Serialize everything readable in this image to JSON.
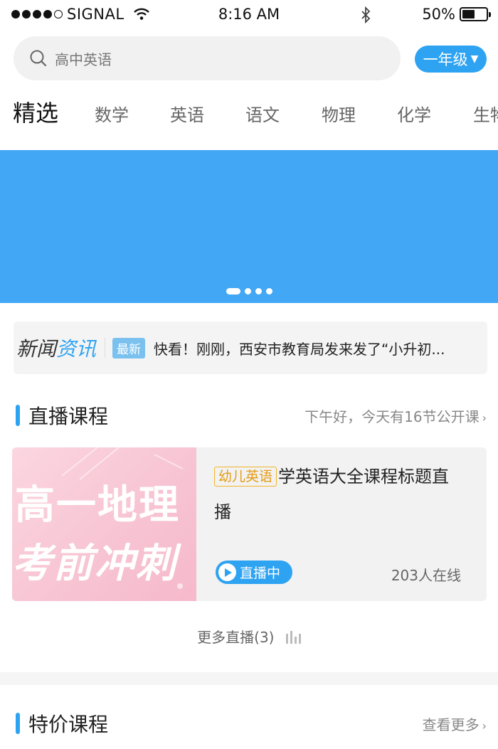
{
  "status_bar": {
    "carrier": "SIGNAL",
    "time": "8:16 AM",
    "battery": "50%"
  },
  "search": {
    "placeholder": "高中英语"
  },
  "grade_selector": {
    "label": "一年级"
  },
  "tabs": [
    {
      "label": "精选",
      "active": true
    },
    {
      "label": "数学",
      "active": false
    },
    {
      "label": "英语",
      "active": false
    },
    {
      "label": "语文",
      "active": false
    },
    {
      "label": "物理",
      "active": false
    },
    {
      "label": "化学",
      "active": false
    },
    {
      "label": "生物",
      "active": false
    }
  ],
  "banner": {
    "color": "#42a7f5",
    "slide_count": 4,
    "active_slide": 1
  },
  "news": {
    "logo_part1": "新闻",
    "logo_part2": "资讯",
    "badge": "最新",
    "headline": "快看！刚刚，西安市教育局发来发了“小升初..."
  },
  "live_section": {
    "title": "直播课程",
    "more": "下午好，今天有16节公开课",
    "card": {
      "thumb_line1": "高一地理",
      "thumb_line2": "考前冲刺",
      "tag": "幼儿英语",
      "title": "学英语大全课程标题直播",
      "status": "直播中",
      "online": "203人在线"
    },
    "more_live": "更多直播(3)"
  },
  "special_section": {
    "title": "特价课程",
    "more": "查看更多"
  },
  "colors": {
    "accent": "#2ea3f2",
    "tag": "#f0b42a"
  }
}
